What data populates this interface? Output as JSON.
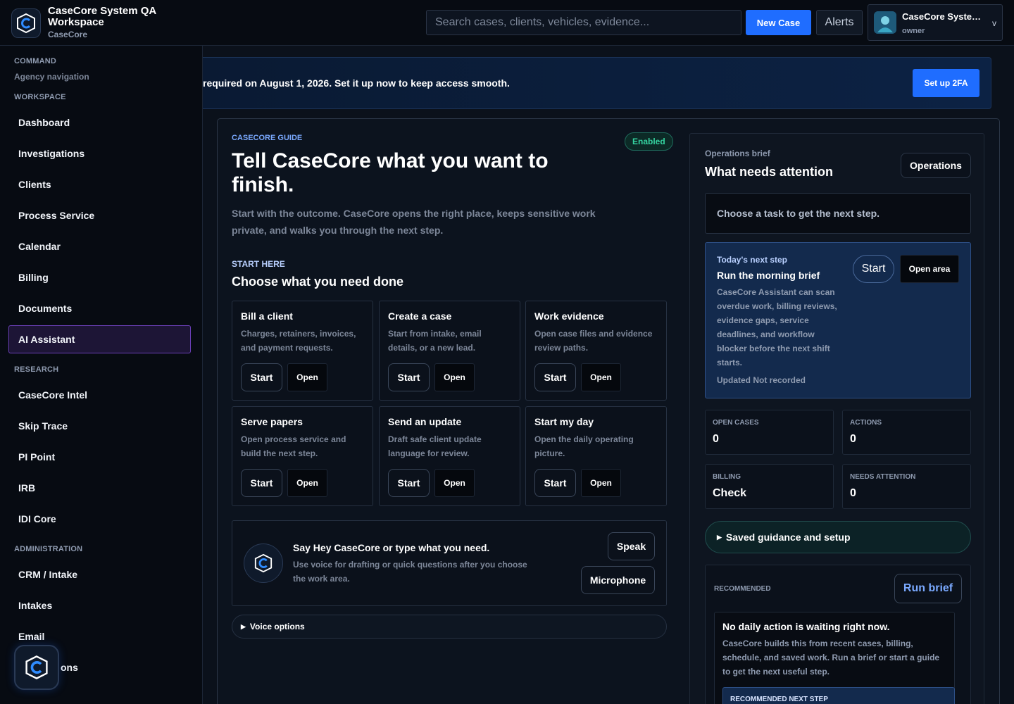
{
  "header": {
    "title": "CaseCore System QA Workspace",
    "subtitle": "CaseCore",
    "search_placeholder": "Search cases, clients, vehicles, evidence...",
    "new_case": "New Case",
    "alerts": "Alerts",
    "user_name": "CaseCore System QA",
    "user_role": "owner",
    "user_chevron": "v"
  },
  "sidebar": {
    "command_heading": "COMMAND",
    "command_sub": "Agency navigation",
    "workspace_heading": "WORKSPACE",
    "workspace_items": [
      "Dashboard",
      "Investigations",
      "Clients",
      "Process Service",
      "Calendar",
      "Billing",
      "Documents",
      "AI Assistant"
    ],
    "research_heading": "RESEARCH",
    "research_items": [
      "CaseCore Intel",
      "Skip Trace",
      "PI Point",
      "IRB",
      "IDI Core"
    ],
    "admin_heading": "ADMINISTRATION",
    "admin_items": [
      "CRM / Intake",
      "Intakes",
      "Email",
      "ons"
    ]
  },
  "banner": {
    "text": "required on August 1, 2026. Set it up now to keep access smooth.",
    "button": "Set up 2FA"
  },
  "guide": {
    "label": "CASECORE GUIDE",
    "status": "Enabled",
    "headline": "Tell CaseCore what you want to finish.",
    "lede": "Start with the outcome. CaseCore opens the right place, keeps sensitive work private, and walks you through the next step.",
    "start_label": "START HERE",
    "choose": "Choose what you need done",
    "start_btn": "Start",
    "open_btn": "Open",
    "tasks": [
      {
        "title": "Bill a client",
        "desc": "Charges, retainers, invoices, and payment requests."
      },
      {
        "title": "Create a case",
        "desc": "Start from intake, email details, or a new lead."
      },
      {
        "title": "Work evidence",
        "desc": "Open case files and evidence review paths."
      },
      {
        "title": "Serve papers",
        "desc": "Open process service and build the next step."
      },
      {
        "title": "Send an update",
        "desc": "Draft safe client update language for review."
      },
      {
        "title": "Start my day",
        "desc": "Open the daily operating picture."
      }
    ],
    "voice_title": "Say Hey CaseCore or type what you need.",
    "voice_desc": "Use voice for drafting or quick questions after you choose the work area.",
    "voice_speak": "Speak",
    "voice_mic": "Microphone",
    "voice_options": "Voice options"
  },
  "ops": {
    "label": "Operations brief",
    "title": "What needs attention",
    "button": "Operations",
    "choose_task": "Choose a task to get the next step.",
    "next_label": "Today's next step",
    "next_title": "Run the morning brief",
    "next_desc": "CaseCore Assistant can scan overdue work, billing reviews, evidence gaps, service deadlines, and workflow blocker before the next shift starts.",
    "next_updated": "Updated Not recorded",
    "next_start": "Start",
    "next_open": "Open area",
    "stats": [
      {
        "label": "OPEN CASES",
        "value": "0"
      },
      {
        "label": "ACTIONS",
        "value": "0"
      },
      {
        "label": "BILLING",
        "value": "Check"
      },
      {
        "label": "NEEDS ATTENTION",
        "value": "0"
      }
    ],
    "saved": "Saved guidance and setup",
    "rec_label": "RECOMMENDED",
    "rec_btn": "Run brief",
    "rec_title": "No daily action is waiting right now.",
    "rec_desc": "CaseCore builds this from recent cases, billing, schedule, and saved work. Run a brief or start a guide to get the next useful step.",
    "rec_next": "RECOMMENDED NEXT STEP"
  },
  "colors": {
    "accent": "#1f6dff",
    "active_nav": "#6a3fb6",
    "success": "#35d3a0"
  }
}
